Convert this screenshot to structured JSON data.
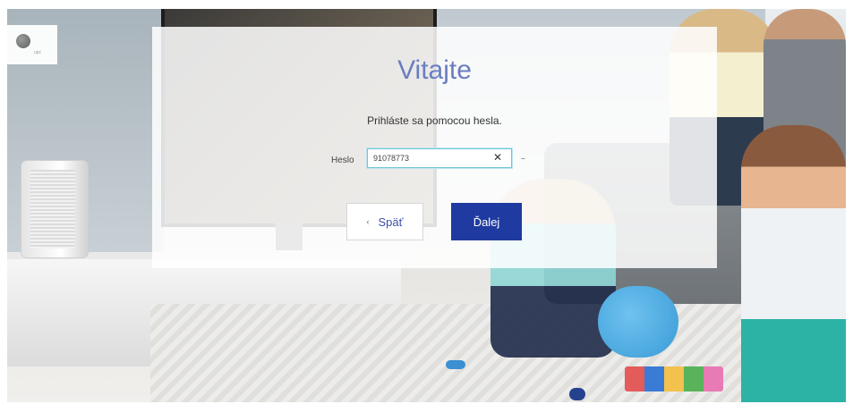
{
  "background": {
    "scene": "family-living-room"
  },
  "logo": {
    "icon": "upc-globe-icon",
    "text": "upc"
  },
  "dialog": {
    "title": "Vitajte",
    "subtitle": "Prihláste sa pomocou hesla.",
    "password_label": "Heslo",
    "password_value": "91078773",
    "clear_icon": "✕",
    "dash": "–",
    "back_chevron": "‹",
    "back_label": "Späť",
    "next_label": "Ďalej",
    "colors": {
      "title": "#6a7ec0",
      "primary": "#1f3aa0",
      "focus": "#6cc6da"
    }
  }
}
